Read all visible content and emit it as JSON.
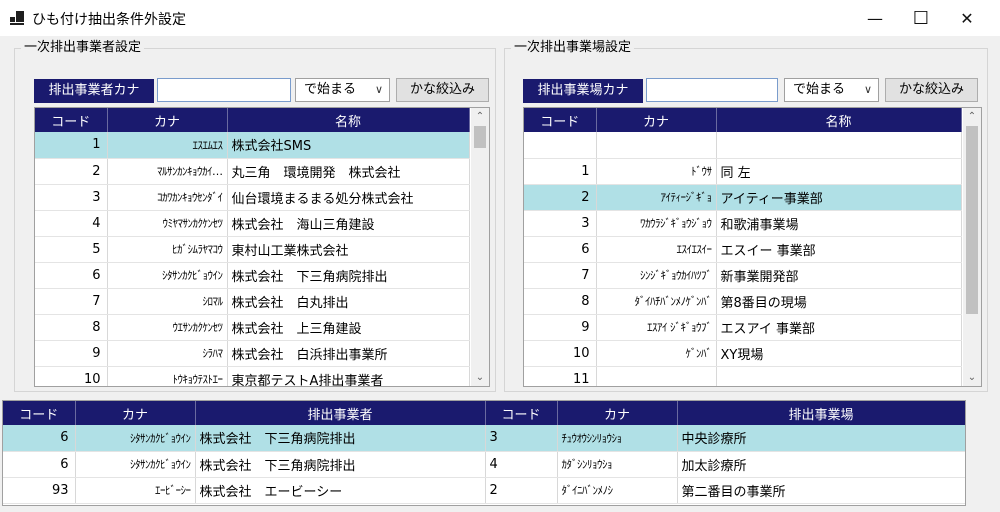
{
  "window": {
    "title": "ひも付け抽出条件外設定",
    "minimize": "—",
    "maximize": "☐",
    "close": "✕"
  },
  "left": {
    "group_title": "一次排出事業者設定",
    "search_label": "排出事業者カナ",
    "search_value": "",
    "match_mode": "で始まる",
    "filter_button": "かな絞込み",
    "columns": [
      "コード",
      "カナ",
      "名称"
    ],
    "rows": [
      {
        "code": "1",
        "kana": "ｴｽｴﾑｴｽ",
        "name": "株式会社SMS"
      },
      {
        "code": "2",
        "kana": "ﾏﾙｻﾝｶﾝｷｮｳｶｲ…",
        "name": "丸三角　環境開発　株式会社"
      },
      {
        "code": "3",
        "kana": "ｺｶﾜｶﾝｷｮｳｾﾝﾀﾞｲ",
        "name": "仙台環境まるまる処分株式会社"
      },
      {
        "code": "4",
        "kana": "ｳﾐﾔﾏｻﾝｶｸｹﾝｾﾂ",
        "name": "株式会社　海山三角建設"
      },
      {
        "code": "5",
        "kana": "ﾋｶﾞｼﾑﾗﾔﾏｺｳ",
        "name": "東村山工業株式会社"
      },
      {
        "code": "6",
        "kana": "ｼﾀｻﾝｶｸﾋﾞｮｳｲﾝ",
        "name": "株式会社　下三角病院排出"
      },
      {
        "code": "7",
        "kana": "ｼﾛﾏﾙ",
        "name": "株式会社　白丸排出"
      },
      {
        "code": "8",
        "kana": "ｳｴｻﾝｶｸｹﾝｾﾂ",
        "name": "株式会社　上三角建設"
      },
      {
        "code": "9",
        "kana": "ｼﾗﾊﾏ",
        "name": "株式会社　白浜排出事業所"
      },
      {
        "code": "10",
        "kana": "ﾄｳｷｮｳﾃｽﾄｴｰ",
        "name": "東京都テストA排出事業者"
      }
    ]
  },
  "right": {
    "group_title": "一次排出事業場設定",
    "search_label": "排出事業場カナ",
    "search_value": "",
    "match_mode": "で始まる",
    "filter_button": "かな絞込み",
    "columns": [
      "コード",
      "カナ",
      "名称"
    ],
    "rows": [
      {
        "code": "",
        "kana": "",
        "name": ""
      },
      {
        "code": "1",
        "kana": "ﾄﾞｳｻ",
        "name": "同 左"
      },
      {
        "code": "2",
        "kana": "ｱｲﾃｨｰｼﾞｷﾞｮ",
        "name": "アイティー事業部"
      },
      {
        "code": "3",
        "kana": "ﾜｶｳﾗｼﾞｷﾞｮｳｼﾞｮｳ",
        "name": "和歌浦事業場"
      },
      {
        "code": "6",
        "kana": "ｴｽｲｴｽｲｰ",
        "name": "エスイー 事業部"
      },
      {
        "code": "7",
        "kana": "ｼﾝｼﾞｷﾞｮｳｶｲﾊﾂﾌﾞ",
        "name": "新事業開発部"
      },
      {
        "code": "8",
        "kana": "ﾀﾞｲﾊﾁﾊﾞﾝﾒﾉｹﾞﾝﾊﾞ",
        "name": "第8番目の現場"
      },
      {
        "code": "9",
        "kana": "ｴｽｱｲ ｼﾞｷﾞｮｳﾌﾞ",
        "name": "エスアイ 事業部"
      },
      {
        "code": "10",
        "kana": "ｹﾞﾝﾊﾞ",
        "name": "XY現場"
      },
      {
        "code": "11",
        "kana": "",
        "name": ""
      }
    ]
  },
  "bottom": {
    "columns": [
      "コード",
      "カナ",
      "排出事業者",
      "コード",
      "カナ",
      "排出事業場"
    ],
    "rows": [
      {
        "code1": "6",
        "kana1": "ｼﾀｻﾝｶｸﾋﾞｮｳｲﾝ",
        "name1": "株式会社　下三角病院排出",
        "code2": "3",
        "kana2": "ﾁｭｳｵｳｼﾝﾘｮｳｼｮ",
        "name2": "中央診療所"
      },
      {
        "code1": "6",
        "kana1": "ｼﾀｻﾝｶｸﾋﾞｮｳｲﾝ",
        "name1": "株式会社　下三角病院排出",
        "code2": "4",
        "kana2": "ｶﾀﾞｼﾝﾘｮｳｼｮ",
        "name2": "加太診療所"
      },
      {
        "code1": "93",
        "kana1": "ｴｰﾋﾞｰｼｰ",
        "name1": "株式会社　エービーシー",
        "code2": "2",
        "kana2": "ﾀﾞｲﾆﾊﾞﾝﾒﾉｼ",
        "name2": "第二番目の事業所"
      }
    ]
  }
}
